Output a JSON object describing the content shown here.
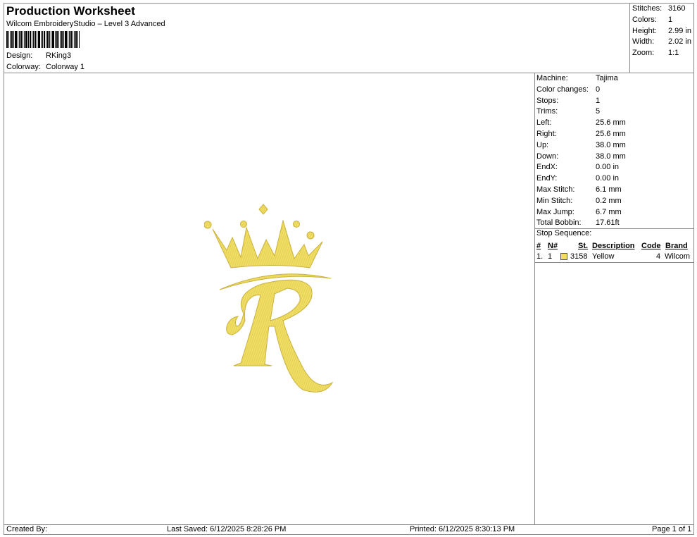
{
  "header": {
    "title": "Production Worksheet",
    "subtitle": "Wilcom EmbroideryStudio – Level 3 Advanced",
    "design_label": "Design:",
    "design_value": "RKing3",
    "colorway_label": "Colorway:",
    "colorway_value": "Colorway 1"
  },
  "summary": {
    "stitches_label": "Stitches:",
    "stitches_value": "3160",
    "colors_label": "Colors:",
    "colors_value": "1",
    "height_label": "Height:",
    "height_value": "2.99 in",
    "width_label": "Width:",
    "width_value": "2.02 in",
    "zoom_label": "Zoom:",
    "zoom_value": "1:1"
  },
  "machine_info": [
    {
      "label": "Machine:",
      "value": "Tajima"
    },
    {
      "label": "Color changes:",
      "value": "0"
    },
    {
      "label": "Stops:",
      "value": "1"
    },
    {
      "label": "Trims:",
      "value": "5"
    },
    {
      "label": "Left:",
      "value": "25.6 mm"
    },
    {
      "label": "Right:",
      "value": "25.6 mm"
    },
    {
      "label": "Up:",
      "value": "38.0 mm"
    },
    {
      "label": "Down:",
      "value": "38.0 mm"
    },
    {
      "label": "EndX:",
      "value": "0.00 in"
    },
    {
      "label": "EndY:",
      "value": "0.00 in"
    },
    {
      "label": "Max Stitch:",
      "value": "6.1 mm"
    },
    {
      "label": "Min Stitch:",
      "value": "0.2 mm"
    },
    {
      "label": "Max Jump:",
      "value": "6.7 mm"
    },
    {
      "label": "Total Bobbin:",
      "value": "17.61ft"
    }
  ],
  "stop_sequence": {
    "label": "Stop Sequence:",
    "headers": {
      "num": "#",
      "needle": "N#",
      "stitches": "St.",
      "description": "Description",
      "code": "Code",
      "brand": "Brand"
    },
    "rows": [
      {
        "num": "1.",
        "needle": "1",
        "stitches": "3158",
        "description": "Yellow",
        "code": "4",
        "brand": "Wilcom",
        "color": "#f4dd5c"
      }
    ]
  },
  "footer": {
    "created_by": "Created By:",
    "last_saved": "Last Saved: 6/12/2025 8:28:26 PM",
    "printed": "Printed: 6/12/2025 8:30:13 PM",
    "page": "Page 1 of 1"
  },
  "design_preview": {
    "letter": "R",
    "thread_color": "#f0dd63",
    "shadow_color": "#c9b23c"
  }
}
